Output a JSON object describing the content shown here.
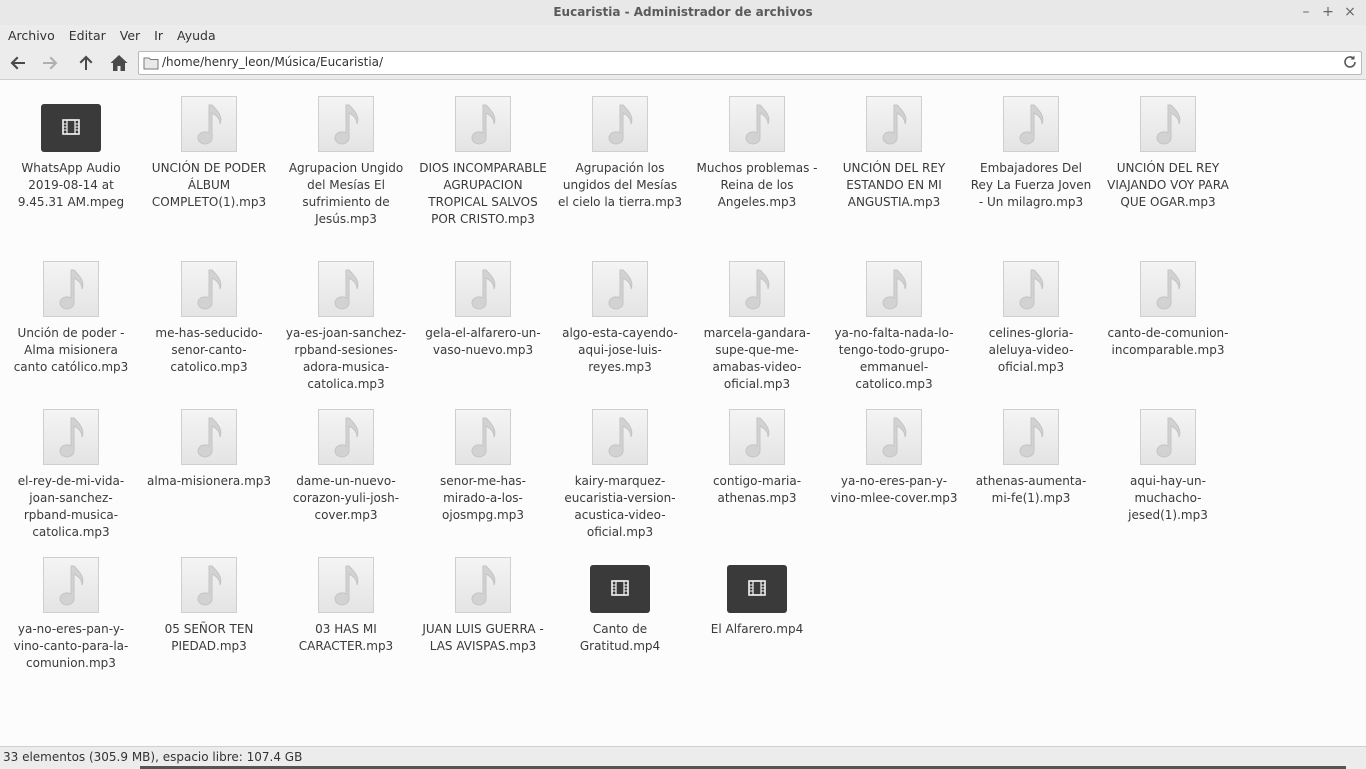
{
  "window": {
    "title": "Eucaristia - Administrador de archivos"
  },
  "window_controls": [
    "–",
    "+",
    "×"
  ],
  "menu": [
    "Archivo",
    "Editar",
    "Ver",
    "Ir",
    "Ayuda"
  ],
  "toolbar": {
    "path": "/home/henry_leon/Música/Eucaristia/"
  },
  "files": [
    {
      "name": "WhatsApp Audio 2019-08-14 at 9.45.31 AM.mpeg",
      "type": "video"
    },
    {
      "name": "UNCIÓN DE PODER ÁLBUM COMPLETO(1).mp3",
      "type": "audio"
    },
    {
      "name": "Agrupacion Ungido del Mesías El sufrimiento de Jesús.mp3",
      "type": "audio"
    },
    {
      "name": "DIOS INCOMPARABLE AGRUPACION TROPICAL SALVOS POR CRISTO.mp3",
      "type": "audio"
    },
    {
      "name": "Agrupación los ungidos del Mesías el cielo  la tierra.mp3",
      "type": "audio"
    },
    {
      "name": "Muchos problemas - Reina de los Angeles.mp3",
      "type": "audio"
    },
    {
      "name": "UNCIÓN DEL REY ESTANDO EN MI ANGUSTIA.mp3",
      "type": "audio"
    },
    {
      "name": "Embajadores Del Rey La Fuerza Joven - Un milagro.mp3",
      "type": "audio"
    },
    {
      "name": "UNCIÓN DEL REY VIAJANDO VOY PARA QUE OGAR.mp3",
      "type": "audio"
    },
    {
      "name": "Unción de poder - Alma misionera  canto católico.mp3",
      "type": "audio"
    },
    {
      "name": "me-has-seducido-senor-canto-catolico.mp3",
      "type": "audio"
    },
    {
      "name": "ya-es-joan-sanchez-rpband-sesiones-adora-musica-catolica.mp3",
      "type": "audio"
    },
    {
      "name": "gela-el-alfarero-un-vaso-nuevo.mp3",
      "type": "audio"
    },
    {
      "name": "algo-esta-cayendo-aqui-jose-luis-reyes.mp3",
      "type": "audio"
    },
    {
      "name": "marcela-gandara-supe-que-me-amabas-video-oficial.mp3",
      "type": "audio"
    },
    {
      "name": "ya-no-falta-nada-lo-tengo-todo-grupo-emmanuel-catolico.mp3",
      "type": "audio"
    },
    {
      "name": "celines-gloria-aleluya-video-oficial.mp3",
      "type": "audio"
    },
    {
      "name": "canto-de-comunion-incomparable.mp3",
      "type": "audio"
    },
    {
      "name": "el-rey-de-mi-vida-joan-sanchez-rpband-musica-catolica.mp3",
      "type": "audio"
    },
    {
      "name": "alma-misionera.mp3",
      "type": "audio"
    },
    {
      "name": "dame-un-nuevo-corazon-yuli-josh-cover.mp3",
      "type": "audio"
    },
    {
      "name": "senor-me-has-mirado-a-los-ojosmpg.mp3",
      "type": "audio"
    },
    {
      "name": "kairy-marquez-eucaristia-version-acustica-video-oficial.mp3",
      "type": "audio"
    },
    {
      "name": "contigo-maria-athenas.mp3",
      "type": "audio"
    },
    {
      "name": "ya-no-eres-pan-y-vino-mlee-cover.mp3",
      "type": "audio"
    },
    {
      "name": "athenas-aumenta-mi-fe(1).mp3",
      "type": "audio"
    },
    {
      "name": "aqui-hay-un-muchacho-jesed(1).mp3",
      "type": "audio"
    },
    {
      "name": "ya-no-eres-pan-y-vino-canto-para-la-comunion.mp3",
      "type": "audio"
    },
    {
      "name": "05 SEÑOR TEN PIEDAD.mp3",
      "type": "audio"
    },
    {
      "name": "03 HAS MI CARACTER.mp3",
      "type": "audio"
    },
    {
      "name": "JUAN LUIS GUERRA - LAS AVISPAS.mp3",
      "type": "audio"
    },
    {
      "name": "Canto de Gratitud.mp4",
      "type": "video"
    },
    {
      "name": "El Alfarero.mp4",
      "type": "video"
    }
  ],
  "statusbar": {
    "text": "33 elementos (305.9 MB), espacio libre: 107.4 GB"
  }
}
